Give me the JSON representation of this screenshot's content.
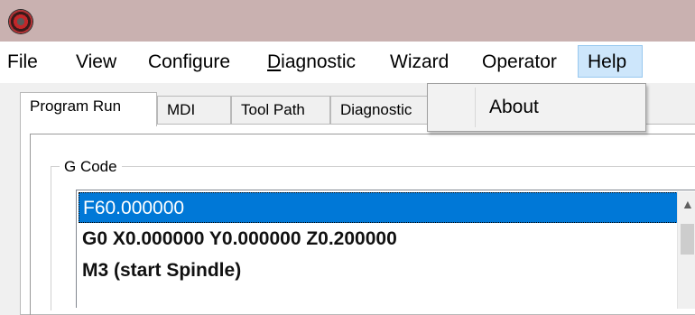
{
  "window": {
    "app_icon": "cnc-app-icon"
  },
  "menubar": {
    "items": [
      {
        "label": "File"
      },
      {
        "label": "View"
      },
      {
        "label": "Configure"
      },
      {
        "label": "Diagnostic"
      },
      {
        "label": "Wizard"
      },
      {
        "label": "Operator"
      },
      {
        "label": "Help"
      }
    ]
  },
  "help_menu": {
    "items": [
      {
        "label": "About"
      }
    ]
  },
  "tabs": [
    {
      "label": "Program Run"
    },
    {
      "label": "MDI"
    },
    {
      "label": "Tool Path"
    },
    {
      "label": "Diagnostic"
    }
  ],
  "gcode_group": {
    "label": "G Code",
    "lines": [
      "F60.000000",
      "G0 X0.000000 Y0.000000 Z0.200000",
      "M3 (start Spindle)"
    ]
  },
  "colors": {
    "selection": "#0078d7",
    "menu_highlight": "#cde6fb",
    "titlebar": "#c9b1b0"
  }
}
